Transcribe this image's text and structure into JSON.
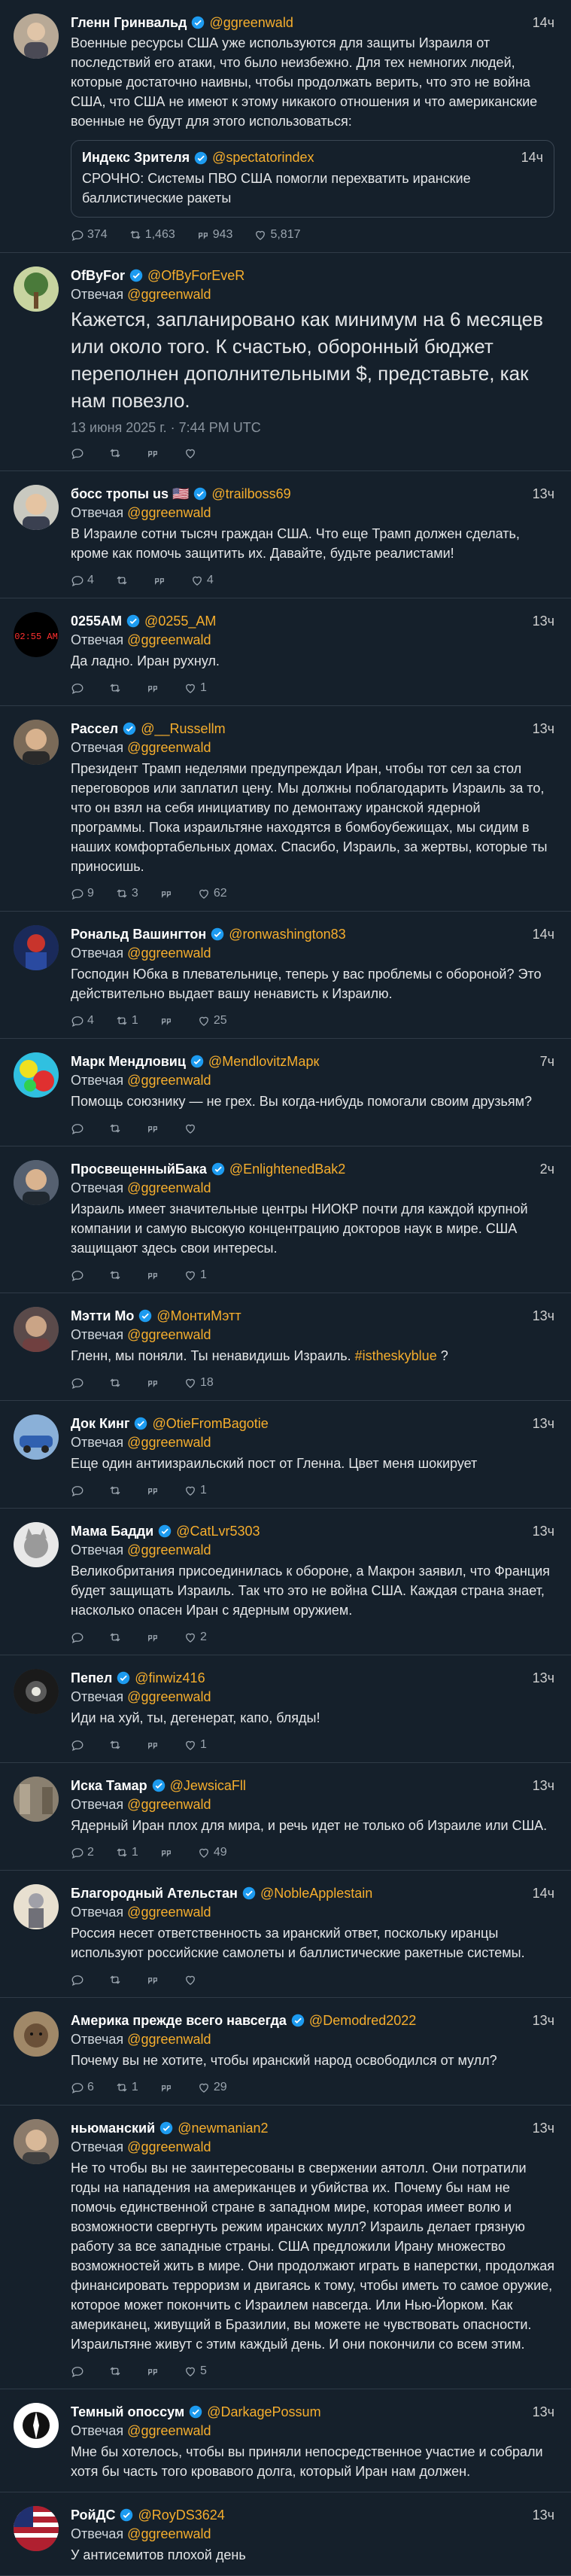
{
  "posts": [
    {
      "name": "Гленн Гринвальд",
      "handle": "@ggreenwald",
      "time": "14ч",
      "text": "Военные ресурсы США уже используются для защиты Израиля от последствий его атаки, что было неизбежно. Для тех немногих людей, которые достаточно наивны, чтобы продолжать верить, что это не война США, что США не имеют к этому никакого отношения и что американские военные не будут для этого использоваться:",
      "quote": {
        "name": "Индекс Зрителя",
        "handle": "@spectatorindex",
        "time": "14ч",
        "text": "СРОЧНО: Системы ПВО США помогли перехватить иранские баллистические ракеты"
      },
      "stats": [
        "374",
        "1,463",
        "943",
        "5,817"
      ],
      "avatar": "person"
    },
    {
      "name": "OfByFor",
      "handle": "@OfByForEveR",
      "replying_label": "Отвечая",
      "replying_to": "@ggreenwald",
      "text": "Кажется, запланировано как минимум на 6 месяцев или около того. К счастью, оборонный бюджет переполнен дополнительными $, представьте, как нам повезло.",
      "date": "13 июня 2025 г. · 7:44 PM UTC",
      "big": true,
      "stats": [
        "",
        "",
        "",
        ""
      ],
      "avatar": "tree"
    },
    {
      "name": "босс тропы us 🇺🇸",
      "handle": "@trailboss69",
      "time": "13ч",
      "replying_label": "Отвечая",
      "replying_to": "@ggreenwald",
      "text": "В Израиле сотни тысяч граждан США. Что еще Трамп должен сделать, кроме как помочь защитить их. Давайте, будьте реалистами!",
      "stats": [
        "4",
        "",
        "",
        "4"
      ],
      "avatar": "man"
    },
    {
      "name": "0255AM",
      "handle": "@0255_AM",
      "time": "13ч",
      "replying_label": "Отвечая",
      "replying_to": "@ggreenwald",
      "text": "Да ладно. Иран рухнул.",
      "stats": [
        "",
        "",
        "",
        "1"
      ],
      "avatar": "clock"
    },
    {
      "name": "Рассел",
      "handle": "@__Russellm",
      "time": "13ч",
      "replying_label": "Отвечая",
      "replying_to": "@ggreenwald",
      "text": "Президент Трамп неделями предупреждал Иран, чтобы тот сел за стол переговоров или заплатил цену. Мы должны поблагодарить Израиль за то, что он взял на себя инициативу по демонтажу иранской ядерной программы. Пока израильтяне находятся в бомбоубежищах, мы сидим в наших комфортабельных домах. Спасибо, Израиль, за жертвы, которые ты приносишь.",
      "stats": [
        "9",
        "3",
        "",
        "62"
      ],
      "avatar": "man2"
    },
    {
      "name": "Рональд Вашингтон",
      "handle": "@ronwashington83",
      "time": "14ч",
      "replying_label": "Отвечая",
      "replying_to": "@ggreenwald",
      "text": "Господин Юбка в плевательнице, теперь у вас проблемы с обороной? Это действительно выдает вашу ненависть к Израилю.",
      "stats": [
        "4",
        "1",
        "",
        "25"
      ],
      "avatar": "hero"
    },
    {
      "name": "Марк Мендловиц",
      "handle": "@MendlovitzМарк",
      "time": "7ч",
      "replying_label": "Отвечая",
      "replying_to": "@ggreenwald",
      "text": "Помощь союзнику — не грех. Вы когда-нибудь помогали своим друзьям?",
      "stats": [
        "",
        "",
        "",
        ""
      ],
      "avatar": "color"
    },
    {
      "name": "ПросвещенныйБака",
      "handle": "@EnlightenedBak2",
      "time": "2ч",
      "replying_label": "Отвечая",
      "replying_to": "@ggreenwald",
      "text": "Израиль имеет значительные центры НИОКР почти для каждой крупной компании и самую высокую концентрацию докторов наук в мире. США защищают здесь свои интересы.",
      "stats": [
        "",
        "",
        "",
        "1"
      ],
      "avatar": "man3"
    },
    {
      "name": "Мэтти Мо",
      "handle": "@МонтиМэтт",
      "time": "13ч",
      "replying_label": "Отвечая",
      "replying_to": "@ggreenwald",
      "text": "Гленн, мы поняли. Ты ненавидишь Израиль. ",
      "tag": "#istheskyblue",
      "tail": " ?",
      "stats": [
        "",
        "",
        "",
        "18"
      ],
      "avatar": "man4"
    },
    {
      "name": "Док Кинг",
      "handle": "@OtieFromBagotie",
      "time": "13ч",
      "replying_label": "Отвечая",
      "replying_to": "@ggreenwald",
      "text": "Еще один антиизраильский пост от Гленна. Цвет меня шокирует",
      "stats": [
        "",
        "",
        "",
        "1"
      ],
      "avatar": "car"
    },
    {
      "name": "Мама Бадди",
      "handle": "@CatLvr5303",
      "time": "13ч",
      "replying_label": "Отвечая",
      "replying_to": "@ggreenwald",
      "text": "Великобритания присоединилась к обороне, а Макрон заявил, что Франция будет защищать Израиль. Так что это не война США. Каждая страна знает, насколько опасен Иран с ядерным оружием.",
      "stats": [
        "",
        "",
        "",
        "2"
      ],
      "avatar": "cat"
    },
    {
      "name": "Пепел",
      "handle": "@finwiz416",
      "time": "13ч",
      "replying_label": "Отвечая",
      "replying_to": "@ggreenwald",
      "text": "Иди на хуй, ты, дегенерат, капо, бляды!",
      "stats": [
        "",
        "",
        "",
        "1"
      ],
      "avatar": "tunnel"
    },
    {
      "name": "Иска Тамар",
      "handle": "@JewsicaFll",
      "time": "13ч",
      "replying_label": "Отвечая",
      "replying_to": "@ggreenwald",
      "text": "Ядерный Иран плох для мира, и речь идет не только об Израиле или США.",
      "stats": [
        "2",
        "1",
        "",
        "49"
      ],
      "avatar": "street"
    },
    {
      "name": "Благородный Ательстан",
      "handle": "@NobleApplestain",
      "time": "14ч",
      "replying_label": "Отвечая",
      "replying_to": "@ggreenwald",
      "text": "Россия несет ответственность за иранский ответ, поскольку иранцы используют российские самолеты и баллистические ракетные системы.",
      "stats": [
        "",
        "",
        "",
        ""
      ],
      "avatar": "knight"
    },
    {
      "name": "Америка прежде всего навсегда",
      "handle": "@Demodred2022",
      "time": "13ч",
      "replying_label": "Отвечая",
      "replying_to": "@ggreenwald",
      "text": "Почему вы не хотите, чтобы иранский народ освободился от мулл?",
      "stats": [
        "6",
        "1",
        "",
        "29"
      ],
      "avatar": "dog"
    },
    {
      "name": "ньюманский",
      "handle": "@newmanian2",
      "time": "13ч",
      "replying_label": "Отвечая",
      "replying_to": "@ggreenwald",
      "text": "Не то чтобы вы не заинтересованы в свержении аятолл. Они потратили годы на нападения на американцев и убийства их. Почему бы нам не помочь единственной стране в западном мире, которая имеет волю и возможности свергнуть режим иранских мулл? Израиль делает грязную работу за все западные страны. США предложили Ирану множество возможностей жить в мире. Они продолжают играть в наперстки, продолжая финансировать терроризм и двигаясь к тому, чтобы иметь то самое оружие, которое может покончить с Израилем навсегда. Или Нью-Йорком. Как американец, живущий в Бразилии, вы можете не чувствовать опасности. Израильтяне живут с этим каждый день. И они покончили со всем этим.",
      "stats": [
        "",
        "",
        "",
        "5"
      ],
      "avatar": "man5"
    },
    {
      "name": "Темный опоссум",
      "handle": "@DarkagePossum",
      "time": "13ч",
      "replying_label": "Отвечая",
      "replying_to": "@ggreenwald",
      "text": "Мне бы хотелось, чтобы вы приняли непосредственное участие и собрали хотя бы часть того кровавого долга, который Иран нам должен.",
      "stats": [],
      "avatar": "bw"
    },
    {
      "name": "РойДС",
      "handle": "@RoyDS3624",
      "time": "13ч",
      "replying_label": "Отвечая",
      "replying_to": "@ggreenwald",
      "text": "У антисемитов плохой день",
      "stats": [],
      "avatar": "flag"
    }
  ]
}
